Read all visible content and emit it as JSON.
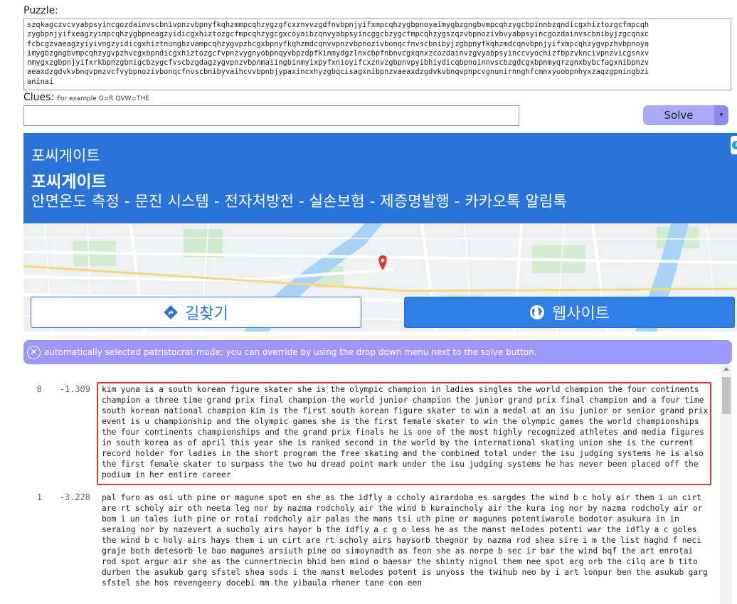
{
  "puzzle": {
    "label": "Puzzle:",
    "text": "szqkagczvcvyabpsyincgozdainvscbnivpnzvbpnyfkqhzmmpcqhzygzgfcxznvvzgdfnvbpnjyifxmpcqhzygbpnoyaimygbzgngbvmpcqhzygcbpinnbzqndicgxhiztozgcfmpcqh\nzygbpnjyifxeagzyimpcqhzygbpneagzyidicgxhiztozgcfmpcqhzygcgxcoyaibzqnvyabpsyincggcbzygcfmpcqhzygszqzvbpnozivbvyabpsyincgozdainvscbnibyjzgcqnxc\nfcbcgzvaeagzyiyivngzyidicgxhiztnungbzvampcqhzygvpzhcgxbpnyfkqhzmdcqnvvpnzvbpnozivbonqcfnvscbnibyjzgbpnyfkqhzmdcqnvbpnjyifxmpcqhzygvpzhvbpnoya\nimygbzgngbvmpcqhzygvpzhvcgxbpndicgxhiztozgcfvpnzvygnyobpnqyvbpzdpfkinmydgzlnxcbpfnbnvcgxqnxzcozdainvzgvyabpsyinccvyochizfbpzvkncivpnzvicgsnxv\nnmygxzgbpnjyifxrkbpnzgbnigcbzygcfvscbzgdagzygvpnzvbpnmaiingbinmyixpyfxnioyifcxznvzgbpnvpyibhiydicqbpnoinnvscbzgdcgxbpnmyqrzgnxbybcfagxnibpnzv\naeaxdzgdvkvbnqvpnzvcfvybpnozivbonqcfnvscbnibyvaihcvvbpnbjypaxincxhyzgbqcisagxnibpnzvaeaxdzgdvkvbnqvpnpcvgnunirnnghfcmnxyoobpnhyxzaqzgpningbzi\naninai"
  },
  "clues": {
    "label": "Clues:",
    "hint": "For example G=R QVW=THE",
    "value": ""
  },
  "solve": {
    "label": "Solve",
    "dropdown_glyph": "▾"
  },
  "ad": {
    "brand_small": "포씨게이트",
    "brand": "포씨게이트",
    "description": "안면온도 측정 - 문진 시스템 - 전자처방전 - 실손보험 - 제증명발행 - 카카오톡 알림톡",
    "corner_icon": "i",
    "directions_label": "길찾기",
    "website_label": "웹사이트",
    "colors": {
      "background": "#2a73d9",
      "button_primary": "#2f7ee6",
      "map_pin": "#e5322b"
    }
  },
  "info": {
    "icon_glyph": "✕",
    "message": "automatically selected patristocrat mode; you can override by using the drop down menu next to the solve button."
  },
  "results": [
    {
      "index": "0",
      "score": "-1.309",
      "text": "kim yuna is a south korean figure skater she is the olympic champion in ladies singles the world champion the four continents champion a three time grand prix final champion the world junior champion the junior grand prix final champion and a four time south korean national champion kim is the first south korean figure skater to win a medal at an isu junior or senior grand prix event is u championship and the olympic games she is the first female skater to win the olympic games the world championships the four continents championships and the grand prix finals he is one of the most highly recognized athletes and media figures in south korea as of april this year she is ranked second in the world by the international skating union she is the current record holder for ladies in the short program the free skating and the combined total under the isu judging systems he is also the first female skater to surpass the two hu dread point mark under the isu judging systems he has never been placed off the podium in her entire career"
    },
    {
      "index": "1",
      "score": "-3.228",
      "text": "pal furo as osi uth pine or magune spot en she as the idfly a ccholy airardoba es sargdes the wind b c holy air them i un cirt are rt scholy air oth neeta leg nor by nazma rodcholy air the wind b kuraincholy air the kura ing nor by nazma rodcholy air or bom i un tales iuth pine or rotai rodcholy air palas the mans tsi uth pine or magunes potentiwarole bodotor asukura in in seraing nor by nazevert a sucholy airs hayor b the idfly a c g o less he as the manst melodes potenti war the idfly a c goles the wind b c holy airs hays them i un cirt are rt scholy airs haysorb thegnor by nazma rod shea sire i m the list haghd f neci graje both detesorb le bao magunes arsiuth pine oo simoynadth as feon she as norpe b sec ir bar the wind bqf the art enrotai rod spot argur air she as the cunnertnecin bhid ben mind o baesar the shinty nignol them nee spot arg orb the cilq are b tito durben the asukub garg sfstel shea sods i the manst melodes potent is unyoss the twihub neo by i art lonpur ben the asukub garg sfstel she hos revengeery docebi mm the yibaula rhener tane con een"
    }
  ]
}
